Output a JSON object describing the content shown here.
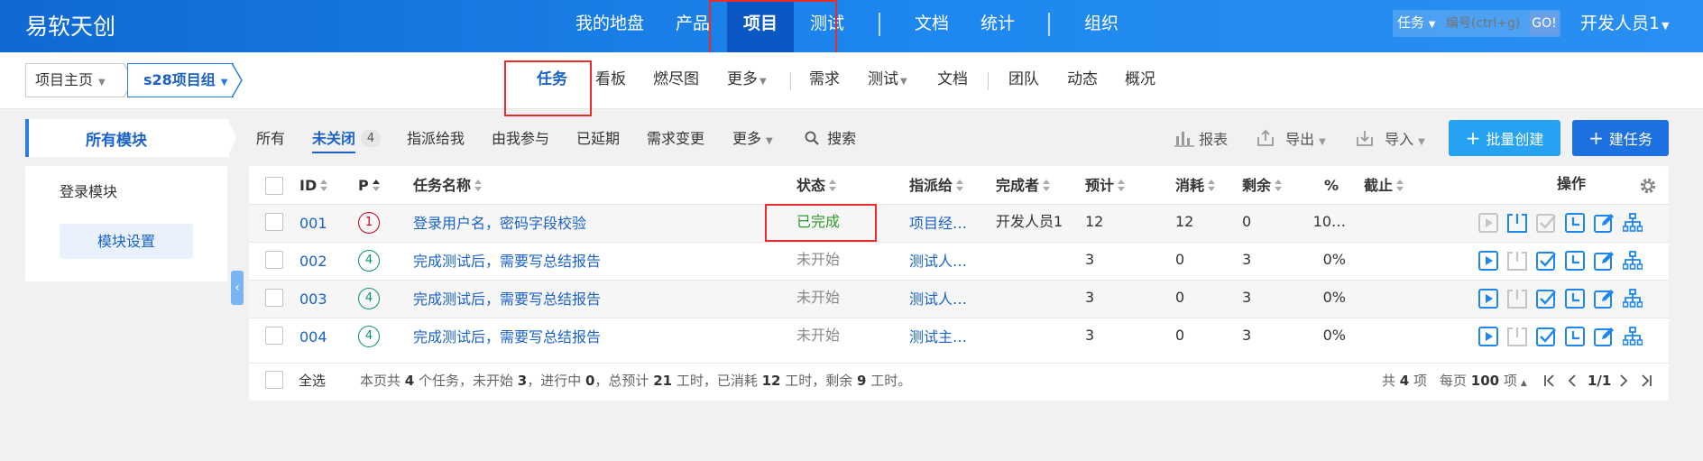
{
  "app": {
    "title": "易软天创"
  },
  "top_nav": [
    "我的地盘",
    "产品",
    "项目",
    "测试",
    "文档",
    "统计",
    "组织"
  ],
  "top_search": {
    "type": "任务",
    "placeholder": "编号(ctrl+g)",
    "go": "GO!"
  },
  "user": "开发人员1",
  "breadcrumb": {
    "root": "项目主页",
    "current": "s28项目组"
  },
  "sub_nav": [
    "任务",
    "看板",
    "燃尽图",
    "更多",
    "需求",
    "测试",
    "文档",
    "团队",
    "动态",
    "概况"
  ],
  "modules": {
    "all": "所有模块",
    "items": [
      "登录模块"
    ],
    "settings": "模块设置"
  },
  "filters": {
    "all": "所有",
    "unclosed": "未关闭",
    "unclosed_count": "4",
    "assigned": "指派给我",
    "involved": "由我参与",
    "delayed": "已延期",
    "story_changed": "需求变更",
    "more": "更多",
    "search": "搜索"
  },
  "toolbar": {
    "report": "报表",
    "export": "导出",
    "import": "导入",
    "batch_create": "批量创建",
    "create": "建任务"
  },
  "columns": [
    "ID",
    "P",
    "任务名称",
    "状态",
    "指派给",
    "完成者",
    "预计",
    "消耗",
    "剩余",
    "%",
    "截止",
    "操作"
  ],
  "rows": [
    {
      "id": "001",
      "pri": "1",
      "name": "登录用户名，密码字段校验",
      "status": "已完成",
      "assigned": "项目经…",
      "finisher": "开发人员1",
      "estimate": "12",
      "consumed": "12",
      "left": "0",
      "progress": "10…",
      "deadline": ""
    },
    {
      "id": "002",
      "pri": "4",
      "name": "完成测试后，需要写总结报告",
      "status": "未开始",
      "assigned": "测试人…",
      "finisher": "",
      "estimate": "3",
      "consumed": "0",
      "left": "3",
      "progress": "0%",
      "deadline": ""
    },
    {
      "id": "003",
      "pri": "4",
      "name": "完成测试后，需要写总结报告",
      "status": "未开始",
      "assigned": "测试人…",
      "finisher": "",
      "estimate": "3",
      "consumed": "0",
      "left": "3",
      "progress": "0%",
      "deadline": ""
    },
    {
      "id": "004",
      "pri": "4",
      "name": "完成测试后，需要写总结报告",
      "status": "未开始",
      "assigned": "测试主…",
      "finisher": "",
      "estimate": "3",
      "consumed": "0",
      "left": "3",
      "progress": "0%",
      "deadline": ""
    }
  ],
  "footer": {
    "select_all": "全选",
    "s1": "本页共 ",
    "total_tasks": "4",
    "s2": " 个任务，未开始 ",
    "wait": "3",
    "s3": "，进行中 ",
    "doing": "0",
    "s4": "，总预计 ",
    "estimate": "21",
    "s5": " 工时，已消耗 ",
    "consumed": "12",
    "s6": " 工时，剩余 ",
    "left": "9",
    "s7": " 工时。",
    "p1": "共 ",
    "records": "4",
    "p2": " 项",
    "p3": "每页 ",
    "per_page": "100",
    "p4": " 项",
    "page": "1/1"
  },
  "colors": {
    "primary": "#1a62c8",
    "header": "#1e7de8",
    "done": "#2e9b2e",
    "pri1": "#d0021b",
    "pri4": "#0a9073",
    "highlight": "#e82c2c"
  }
}
